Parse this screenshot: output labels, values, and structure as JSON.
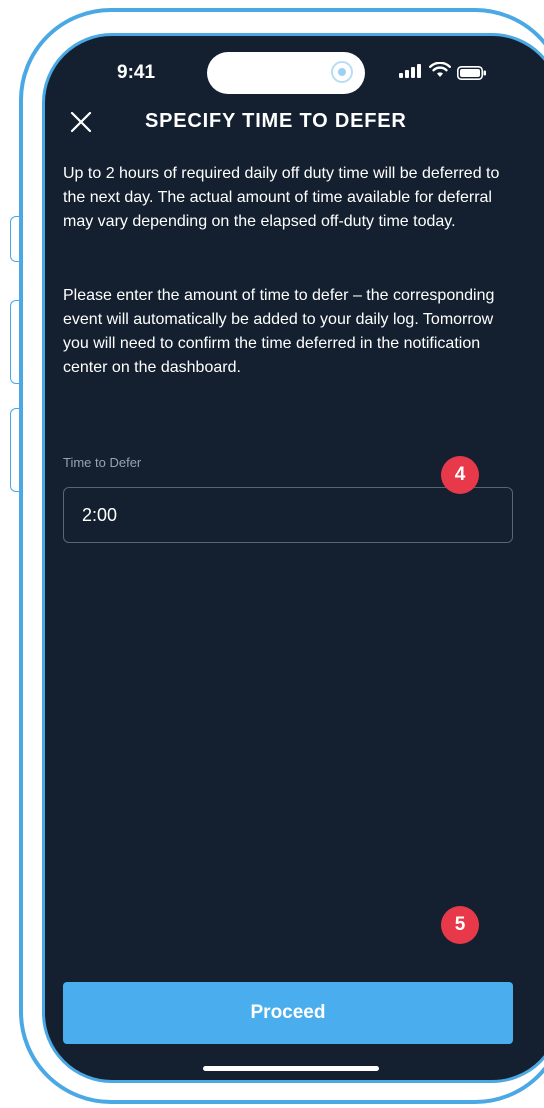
{
  "status_bar": {
    "time": "9:41",
    "icons": [
      "signal-icon",
      "wifi-icon",
      "battery-icon"
    ]
  },
  "header": {
    "title": "SPECIFY TIME TO DEFER",
    "close_icon": "close-icon"
  },
  "body": {
    "paragraph_1": "Up to 2 hours of required daily off duty time will be deferred to the next day. The actual amount of time available for deferral may vary depending on the elapsed off-duty time today.",
    "paragraph_2": "Please enter the amount of time to defer – the corresponding event will automatically be added to your daily log. Tomorrow you will need to confirm the time deferred in the notification center on the dashboard."
  },
  "form": {
    "time_label": "Time to Defer",
    "time_value": "2:00"
  },
  "annotations": {
    "badge_4": "4",
    "badge_5": "5"
  },
  "actions": {
    "proceed_label": "Proceed"
  },
  "colors": {
    "screen_bg": "#14202f",
    "accent": "#4aaeee",
    "frame": "#4aa8e4",
    "badge": "#e8394a"
  }
}
